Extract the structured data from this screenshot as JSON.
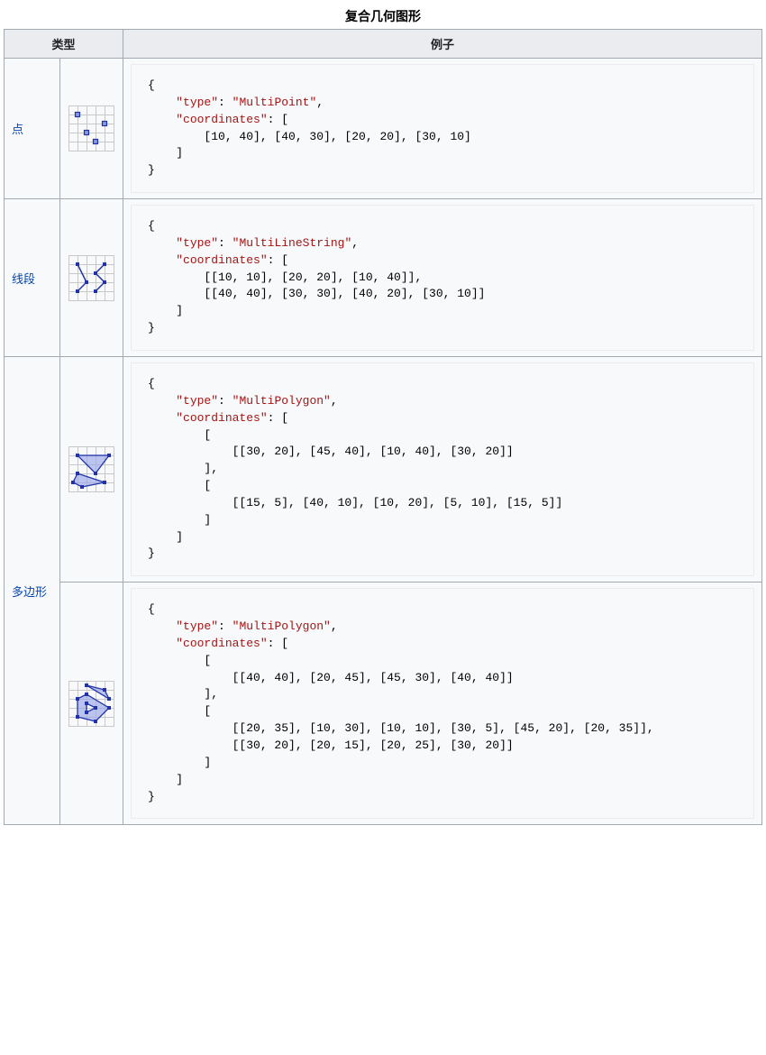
{
  "caption": "复合几何图形",
  "headers": {
    "type": "类型",
    "example": "例子"
  },
  "labels": {
    "point": "点",
    "line": "线段",
    "polygon": "多边形"
  },
  "keys": {
    "type": "\"type\"",
    "coords": "\"coordinates\""
  },
  "vals": {
    "mpoint": "\"MultiPoint\"",
    "mline": "\"MultiLineString\"",
    "mpoly": "\"MultiPolygon\""
  },
  "code": {
    "mpoint_coords": "        [10, 40], [40, 30], [20, 20], [30, 10]",
    "mline_coords": "        [[10, 10], [20, 20], [10, 40]],\n        [[40, 40], [30, 30], [40, 20], [30, 10]]",
    "mpoly1_coords": "        [\n            [[30, 20], [45, 40], [10, 40], [30, 20]]\n        ],\n        [\n            [[15, 5], [40, 10], [10, 20], [5, 10], [15, 5]]\n        ]",
    "mpoly2_coords": "        [\n            [[40, 40], [20, 45], [45, 30], [40, 40]]\n        ],\n        [\n            [[20, 35], [10, 30], [10, 10], [30, 5], [45, 20], [20, 35]],\n            [[30, 20], [20, 15], [20, 25], [30, 20]]\n        ]"
  }
}
